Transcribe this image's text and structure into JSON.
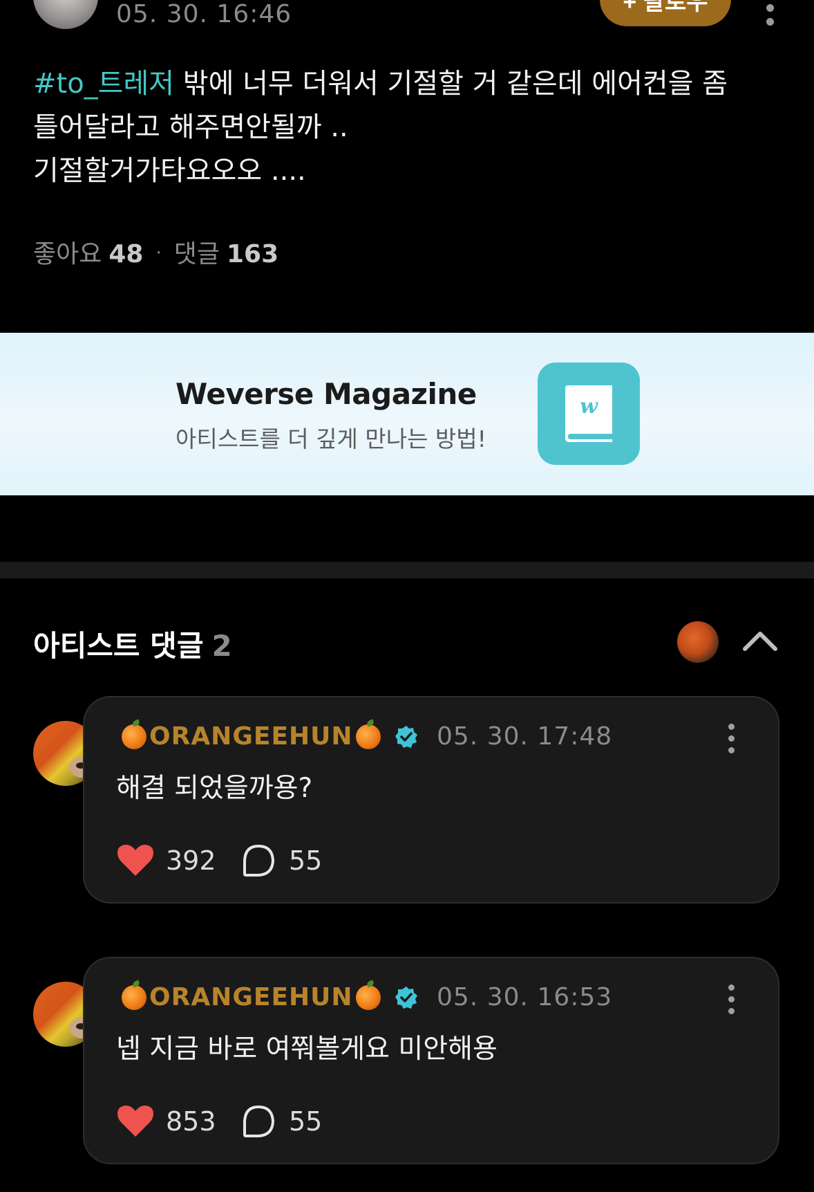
{
  "post": {
    "time": "05. 30. 16:46",
    "follow_label": "+ 팔로우",
    "hashtag": "#to_트레저",
    "line1_rest": " 밖에 너무 더워서 기절할 거 같은데 에어컨을 좀",
    "line2": "틀어달라고 해주면안될까 ..",
    "line3": "기절할거가타요오오 ....",
    "likes_label": "좋아요",
    "likes": "48",
    "comments_label": "댓글",
    "comments": "163"
  },
  "banner": {
    "title": "Weverse Magazine",
    "subtitle": "아티스트를 더 깊게 만나는 방법!"
  },
  "artist_comments": {
    "title": "아티스트 댓글",
    "count": "2",
    "items": [
      {
        "name": "ORANGEEHUN",
        "time": "05. 30. 17:48",
        "text": "해결 되었을까용?",
        "likes": "392",
        "replies": "55"
      },
      {
        "name": "ORANGEEHUN",
        "time": "05. 30. 16:53",
        "text": "넵 지금 바로 여쭤볼게요 미안해용",
        "likes": "853",
        "replies": "55"
      }
    ]
  },
  "colors": {
    "background": "#000000",
    "hashtag": "#45c8c5",
    "follow_button": "#9b6a1d",
    "artist_name": "#b8842b",
    "heart": "#ef5350",
    "verified": "#3fc3d6",
    "banner_icon": "#4fc4cf"
  }
}
